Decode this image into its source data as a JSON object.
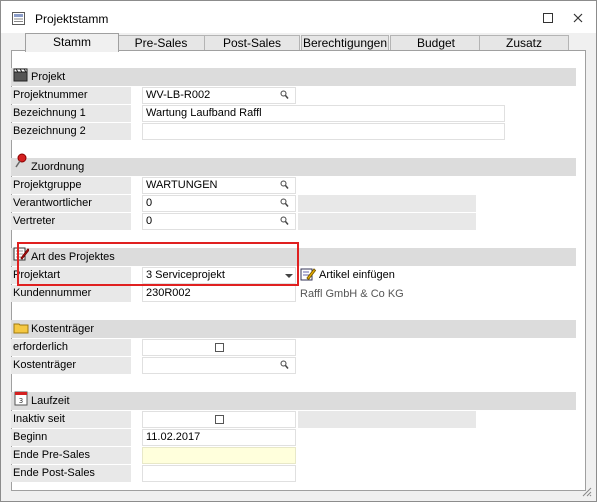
{
  "window": {
    "title": "Projektstamm",
    "minimize_glyph": "☐",
    "close_glyph": "✕"
  },
  "tabs": [
    {
      "label": "Stamm",
      "active": true
    },
    {
      "label": "Pre-Sales",
      "active": false
    },
    {
      "label": "Post-Sales",
      "active": false
    },
    {
      "label": "Berechtigungen",
      "active": false
    },
    {
      "label": "Budget",
      "active": false
    },
    {
      "label": "Zusatz",
      "active": false
    }
  ],
  "sections": {
    "projekt": {
      "title": "Projekt",
      "icon": "clapper-icon",
      "projektnummer": {
        "label": "Projektnummer",
        "value": "WV-LB-R002"
      },
      "bezeichnung1": {
        "label": "Bezeichnung 1",
        "value": "Wartung Laufband Raffl"
      },
      "bezeichnung2": {
        "label": "Bezeichnung 2",
        "value": ""
      }
    },
    "zuordnung": {
      "title": "Zuordnung",
      "icon": "pushpin-icon",
      "projektgruppe": {
        "label": "Projektgruppe",
        "value": "WARTUNGEN"
      },
      "verantwortlicher": {
        "label": "Verantwortlicher",
        "value": "0"
      },
      "vertreter": {
        "label": "Vertreter",
        "value": "0"
      }
    },
    "art": {
      "title": "Art des Projektes",
      "icon": "notepad-pencil-icon",
      "projektart": {
        "label": "Projektart",
        "value": "3 Serviceprojekt"
      },
      "kundennummer": {
        "label": "Kundennummer",
        "value": "230R002",
        "customer_name": "Raffl GmbH & Co KG"
      },
      "artikel_link": "Artikel einfügen"
    },
    "kostentraeger": {
      "title": "Kostenträger",
      "icon": "folder-icon",
      "erforderlich": {
        "label": "erforderlich",
        "checked": false
      },
      "kostentraeger": {
        "label": "Kostenträger",
        "value": ""
      }
    },
    "laufzeit": {
      "title": "Laufzeit",
      "icon": "calendar-icon",
      "inaktiv_seit": {
        "label": "Inaktiv seit",
        "checked": false
      },
      "beginn": {
        "label": "Beginn",
        "value": "11.02.2017"
      },
      "ende_pre_sales": {
        "label": "Ende Pre-Sales",
        "value": ""
      },
      "ende_post_sales": {
        "label": "Ende Post-Sales",
        "value": ""
      }
    }
  },
  "colors": {
    "highlight": "#e02020",
    "section_header": "#dcdcdc",
    "label_bg": "#e8e8e8",
    "yellow_field": "#ffffdc"
  }
}
